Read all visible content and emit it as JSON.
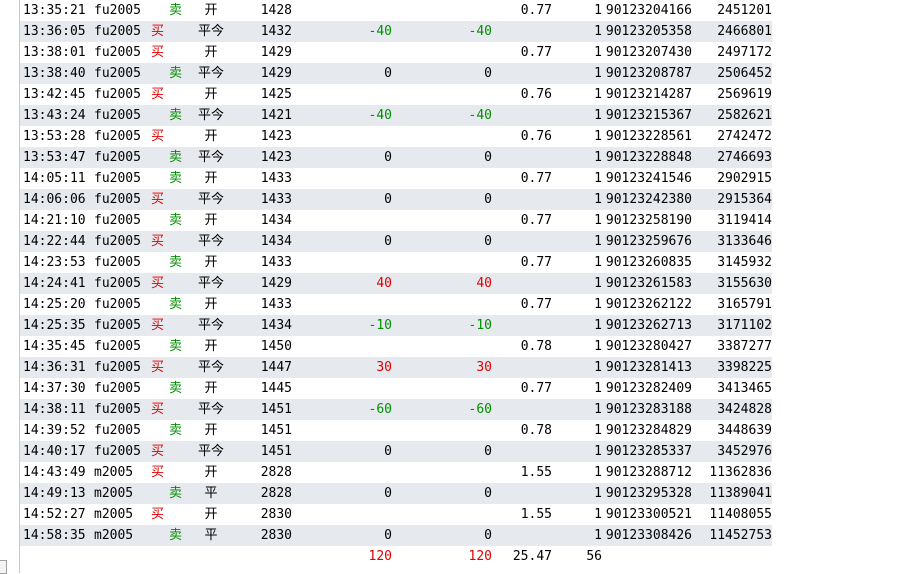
{
  "trades": [
    {
      "time": "13:35:21",
      "code": "fu2005",
      "dir": "卖",
      "oc": "开",
      "price": "1428",
      "pl1": "",
      "pl2": "",
      "fee": "0.77",
      "flag": "1",
      "order": "90123204166",
      "deal": "2451201"
    },
    {
      "time": "13:36:05",
      "code": "fu2005",
      "dir": "买",
      "oc": "平今",
      "price": "1432",
      "pl1": "-40",
      "pl2": "-40",
      "fee": "",
      "flag": "1",
      "order": "90123205358",
      "deal": "2466801"
    },
    {
      "time": "13:38:01",
      "code": "fu2005",
      "dir": "买",
      "oc": "开",
      "price": "1429",
      "pl1": "",
      "pl2": "",
      "fee": "0.77",
      "flag": "1",
      "order": "90123207430",
      "deal": "2497172"
    },
    {
      "time": "13:38:40",
      "code": "fu2005",
      "dir": "卖",
      "oc": "平今",
      "price": "1429",
      "pl1": "0",
      "pl2": "0",
      "fee": "",
      "flag": "1",
      "order": "90123208787",
      "deal": "2506452"
    },
    {
      "time": "13:42:45",
      "code": "fu2005",
      "dir": "买",
      "oc": "开",
      "price": "1425",
      "pl1": "",
      "pl2": "",
      "fee": "0.76",
      "flag": "1",
      "order": "90123214287",
      "deal": "2569619"
    },
    {
      "time": "13:43:24",
      "code": "fu2005",
      "dir": "卖",
      "oc": "平今",
      "price": "1421",
      "pl1": "-40",
      "pl2": "-40",
      "fee": "",
      "flag": "1",
      "order": "90123215367",
      "deal": "2582621"
    },
    {
      "time": "13:53:28",
      "code": "fu2005",
      "dir": "买",
      "oc": "开",
      "price": "1423",
      "pl1": "",
      "pl2": "",
      "fee": "0.76",
      "flag": "1",
      "order": "90123228561",
      "deal": "2742472"
    },
    {
      "time": "13:53:47",
      "code": "fu2005",
      "dir": "卖",
      "oc": "平今",
      "price": "1423",
      "pl1": "0",
      "pl2": "0",
      "fee": "",
      "flag": "1",
      "order": "90123228848",
      "deal": "2746693"
    },
    {
      "time": "14:05:11",
      "code": "fu2005",
      "dir": "卖",
      "oc": "开",
      "price": "1433",
      "pl1": "",
      "pl2": "",
      "fee": "0.77",
      "flag": "1",
      "order": "90123241546",
      "deal": "2902915"
    },
    {
      "time": "14:06:06",
      "code": "fu2005",
      "dir": "买",
      "oc": "平今",
      "price": "1433",
      "pl1": "0",
      "pl2": "0",
      "fee": "",
      "flag": "1",
      "order": "90123242380",
      "deal": "2915364"
    },
    {
      "time": "14:21:10",
      "code": "fu2005",
      "dir": "卖",
      "oc": "开",
      "price": "1434",
      "pl1": "",
      "pl2": "",
      "fee": "0.77",
      "flag": "1",
      "order": "90123258190",
      "deal": "3119414"
    },
    {
      "time": "14:22:44",
      "code": "fu2005",
      "dir": "买",
      "oc": "平今",
      "price": "1434",
      "pl1": "0",
      "pl2": "0",
      "fee": "",
      "flag": "1",
      "order": "90123259676",
      "deal": "3133646"
    },
    {
      "time": "14:23:53",
      "code": "fu2005",
      "dir": "卖",
      "oc": "开",
      "price": "1433",
      "pl1": "",
      "pl2": "",
      "fee": "0.77",
      "flag": "1",
      "order": "90123260835",
      "deal": "3145932"
    },
    {
      "time": "14:24:41",
      "code": "fu2005",
      "dir": "买",
      "oc": "平今",
      "price": "1429",
      "pl1": "40",
      "pl2": "40",
      "fee": "",
      "flag": "1",
      "order": "90123261583",
      "deal": "3155630"
    },
    {
      "time": "14:25:20",
      "code": "fu2005",
      "dir": "卖",
      "oc": "开",
      "price": "1433",
      "pl1": "",
      "pl2": "",
      "fee": "0.77",
      "flag": "1",
      "order": "90123262122",
      "deal": "3165791"
    },
    {
      "time": "14:25:35",
      "code": "fu2005",
      "dir": "买",
      "oc": "平今",
      "price": "1434",
      "pl1": "-10",
      "pl2": "-10",
      "fee": "",
      "flag": "1",
      "order": "90123262713",
      "deal": "3171102"
    },
    {
      "time": "14:35:45",
      "code": "fu2005",
      "dir": "卖",
      "oc": "开",
      "price": "1450",
      "pl1": "",
      "pl2": "",
      "fee": "0.78",
      "flag": "1",
      "order": "90123280427",
      "deal": "3387277"
    },
    {
      "time": "14:36:31",
      "code": "fu2005",
      "dir": "买",
      "oc": "平今",
      "price": "1447",
      "pl1": "30",
      "pl2": "30",
      "fee": "",
      "flag": "1",
      "order": "90123281413",
      "deal": "3398225"
    },
    {
      "time": "14:37:30",
      "code": "fu2005",
      "dir": "卖",
      "oc": "开",
      "price": "1445",
      "pl1": "",
      "pl2": "",
      "fee": "0.77",
      "flag": "1",
      "order": "90123282409",
      "deal": "3413465"
    },
    {
      "time": "14:38:11",
      "code": "fu2005",
      "dir": "买",
      "oc": "平今",
      "price": "1451",
      "pl1": "-60",
      "pl2": "-60",
      "fee": "",
      "flag": "1",
      "order": "90123283188",
      "deal": "3424828"
    },
    {
      "time": "14:39:52",
      "code": "fu2005",
      "dir": "卖",
      "oc": "开",
      "price": "1451",
      "pl1": "",
      "pl2": "",
      "fee": "0.78",
      "flag": "1",
      "order": "90123284829",
      "deal": "3448639"
    },
    {
      "time": "14:40:17",
      "code": "fu2005",
      "dir": "买",
      "oc": "平今",
      "price": "1451",
      "pl1": "0",
      "pl2": "0",
      "fee": "",
      "flag": "1",
      "order": "90123285337",
      "deal": "3452976"
    },
    {
      "time": "14:43:49",
      "code": "m2005",
      "dir": "买",
      "oc": "开",
      "price": "2828",
      "pl1": "",
      "pl2": "",
      "fee": "1.55",
      "flag": "1",
      "order": "90123288712",
      "deal": "11362836"
    },
    {
      "time": "14:49:13",
      "code": "m2005",
      "dir": "卖",
      "oc": "平",
      "price": "2828",
      "pl1": "0",
      "pl2": "0",
      "fee": "",
      "flag": "1",
      "order": "90123295328",
      "deal": "11389041"
    },
    {
      "time": "14:52:27",
      "code": "m2005",
      "dir": "买",
      "oc": "开",
      "price": "2830",
      "pl1": "",
      "pl2": "",
      "fee": "1.55",
      "flag": "1",
      "order": "90123300521",
      "deal": "11408055"
    },
    {
      "time": "14:58:35",
      "code": "m2005",
      "dir": "卖",
      "oc": "平",
      "price": "2830",
      "pl1": "0",
      "pl2": "0",
      "fee": "",
      "flag": "1",
      "order": "90123308426",
      "deal": "11452753"
    }
  ],
  "totals": {
    "pl1": "120",
    "pl2": "120",
    "fee": "25.47",
    "count": "56"
  },
  "colors": {
    "buy": "#e00000",
    "sell": "#009000",
    "alt_row": "#e6e9ed"
  }
}
